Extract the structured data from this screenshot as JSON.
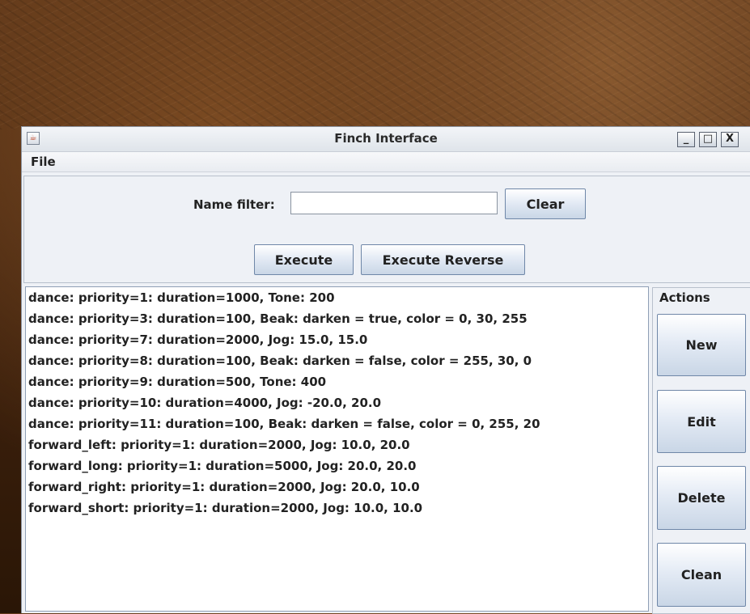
{
  "window": {
    "title": "Finch Interface",
    "app_icon": "java-cup-icon",
    "controls": {
      "minimize": "_",
      "maximize": "□",
      "close": "X"
    }
  },
  "menubar": {
    "file_label": "File"
  },
  "filter": {
    "label": "Name filter:",
    "value": "",
    "clear_label": "Clear"
  },
  "run": {
    "execute_label": "Execute",
    "execute_reverse_label": "Execute Reverse"
  },
  "list": {
    "items": [
      "dance: priority=1: duration=1000, Tone: 200",
      "dance: priority=3: duration=100, Beak: darken = true, color = 0, 30, 255",
      "dance: priority=7: duration=2000, Jog: 15.0, 15.0",
      "dance: priority=8: duration=100, Beak: darken = false, color = 255, 30, 0",
      "dance: priority=9: duration=500, Tone: 400",
      "dance: priority=10: duration=4000, Jog: -20.0, 20.0",
      "dance: priority=11: duration=100, Beak: darken = false, color = 0, 255, 20",
      "forward_left: priority=1: duration=2000, Jog: 10.0, 20.0",
      "forward_long: priority=1: duration=5000, Jog: 20.0, 20.0",
      "forward_right: priority=1: duration=2000, Jog: 20.0, 10.0",
      "forward_short: priority=1: duration=2000, Jog: 10.0, 10.0"
    ]
  },
  "actions": {
    "title": "Actions",
    "new_label": "New",
    "edit_label": "Edit",
    "delete_label": "Delete",
    "clean_label": "Clean"
  }
}
